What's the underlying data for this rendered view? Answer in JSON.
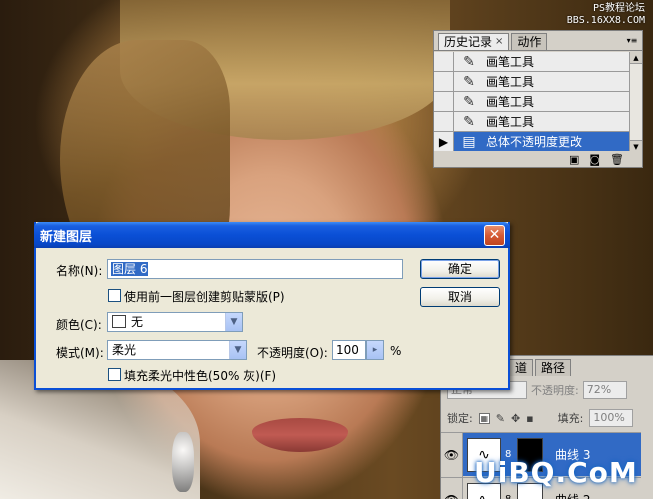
{
  "watermark": {
    "top_line1": "PS教程论坛",
    "top_line2": "BBS.16XX8.COM",
    "bottom": "UiBQ.CoM"
  },
  "history_panel": {
    "tabs": [
      {
        "label": "历史记录",
        "close": "×"
      },
      {
        "label": "动作"
      }
    ],
    "menu_glyph": "▾≡",
    "items": [
      {
        "label": "画笔工具",
        "icon": "brush-icon",
        "glyph": "✎"
      },
      {
        "label": "画笔工具",
        "icon": "brush-icon",
        "glyph": "✎"
      },
      {
        "label": "画笔工具",
        "icon": "brush-icon",
        "glyph": "✎"
      },
      {
        "label": "画笔工具",
        "icon": "brush-icon",
        "glyph": "✎"
      },
      {
        "label": "总体不透明度更改",
        "icon": "layer-opacity-icon",
        "glyph": "▤",
        "selected": true
      }
    ],
    "footer_icons": [
      "new-document-from-state-icon",
      "snapshot-camera-icon",
      "trash-icon"
    ],
    "footer_glyphs": [
      "▣",
      "◙",
      "🗑"
    ]
  },
  "dialog": {
    "title": "新建图层",
    "close_glyph": "✕",
    "name_label": "名称(N):",
    "name_value": "图层 6",
    "clip_checkbox_label": "使用前一图层创建剪贴蒙版(P)",
    "color_label": "颜色(C):",
    "color_value": "无",
    "mode_label": "模式(M):",
    "mode_value": "柔光",
    "opacity_label": "不透明度(O):",
    "opacity_value": "100",
    "opacity_unit": "%",
    "neutral_checkbox_label": "填充柔光中性色(50% 灰)(F)",
    "ok_label": "确定",
    "cancel_label": "取消",
    "dropdown_glyph": "▼",
    "spin_glyph": "▸"
  },
  "layers_panel": {
    "tabs": [
      {
        "label": "道"
      },
      {
        "label": "路径"
      }
    ],
    "blend_mode": "正常",
    "opacity_label": "不透明度:",
    "opacity_value": "72%",
    "lock_label": "锁定:",
    "fill_label": "填充:",
    "fill_value": "100%",
    "layers": [
      {
        "name": "曲线 3",
        "selected": true
      },
      {
        "name": "曲线 2",
        "selected": false
      }
    ],
    "eye_glyph": "👁",
    "chain_glyph": "8"
  },
  "colors": {
    "selection_blue": "#316ac5",
    "titlebar_blue": "#0a4fd6",
    "dialog_bg": "#ece9d8",
    "panel_bg": "#d4d0c8"
  }
}
